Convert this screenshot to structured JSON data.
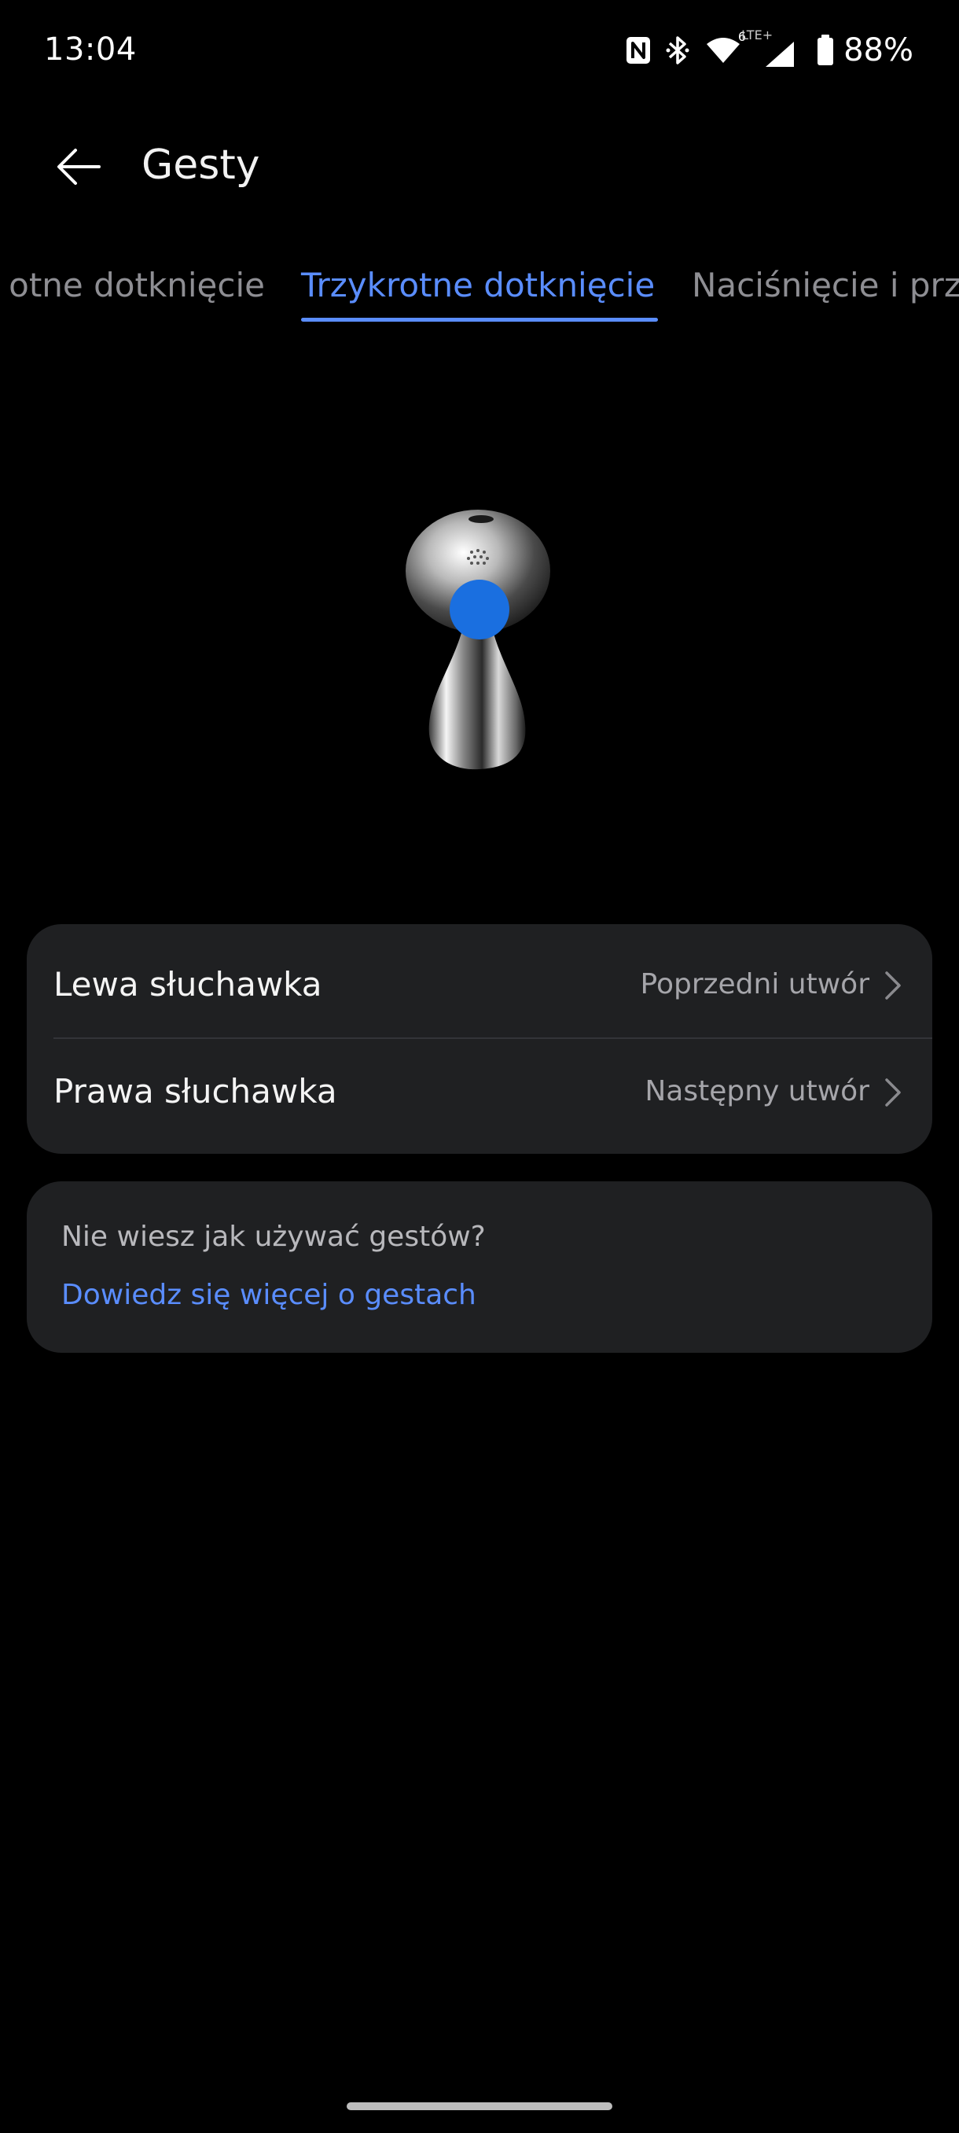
{
  "status_bar": {
    "time": "13:04",
    "battery": "88%",
    "network_label": "LTE+",
    "wifi_badge": "6",
    "icons": [
      "nfc-icon",
      "bluetooth-icon",
      "wifi-icon",
      "signal-icon",
      "battery-icon"
    ]
  },
  "app_bar": {
    "title": "Gesty",
    "back_icon": "back-arrow-icon"
  },
  "tabs": {
    "items": [
      {
        "label": "Dwukrotne dotknięcie"
      },
      {
        "label": "Trzykrotne dotknięcie",
        "active": true
      },
      {
        "label": "Naciśnięcie i przytrzymanie"
      }
    ],
    "visible": [
      "otne dotknięcie",
      "Trzykrotne dotknięcie",
      "Naciśnięcie i prz"
    ],
    "accent_color": "#5a8dff"
  },
  "illustration": {
    "icon": "earbud-icon",
    "highlight_color": "#1a6fe0"
  },
  "settings": {
    "left": {
      "label": "Lewa słuchawka",
      "value": "Poprzedni utwór"
    },
    "right": {
      "label": "Prawa słuchawka",
      "value": "Następny utwór"
    }
  },
  "help": {
    "question": "Nie wiesz jak używać gestów?",
    "link": "Dowiedz się więcej o gestach"
  }
}
